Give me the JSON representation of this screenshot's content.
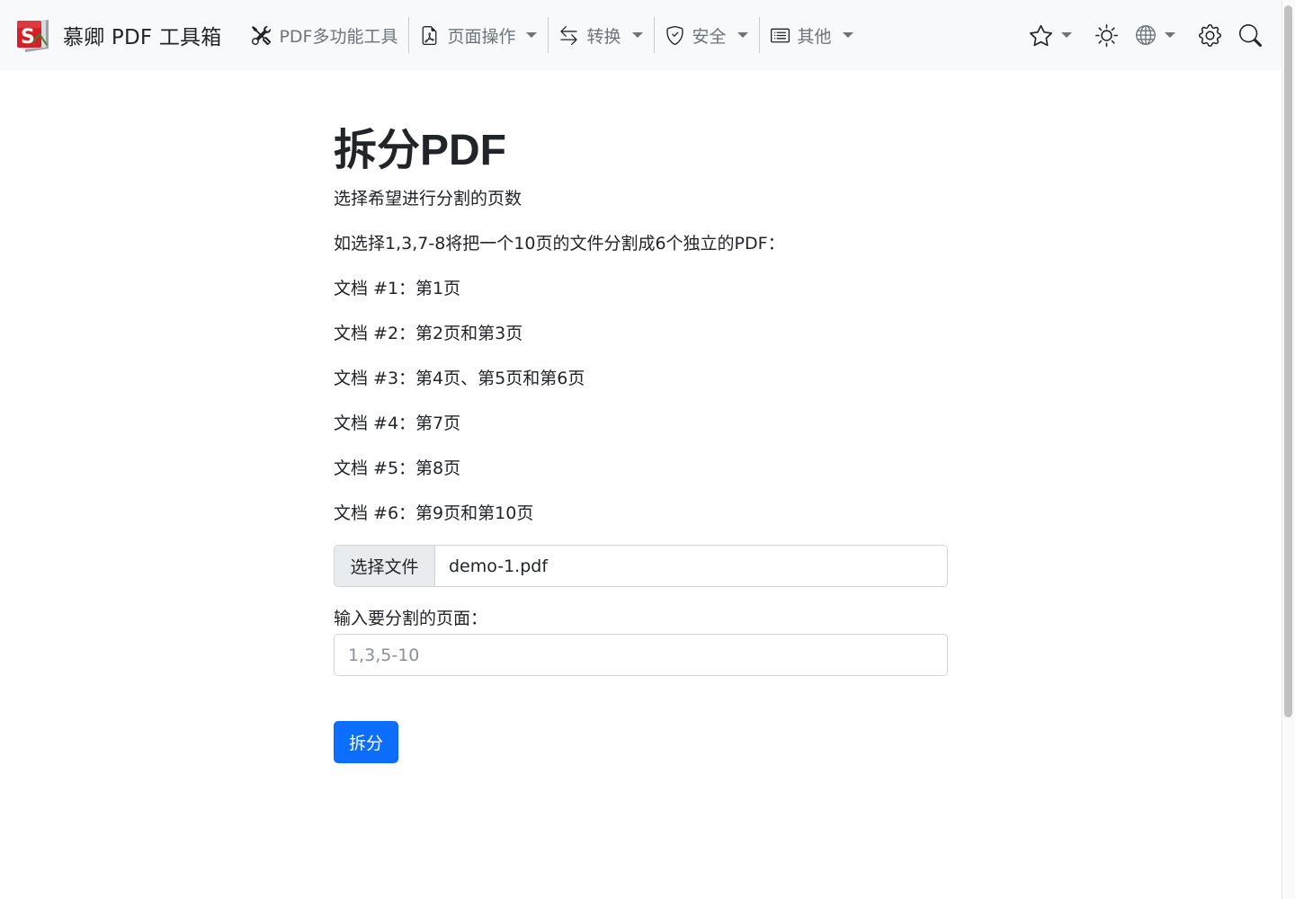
{
  "navbar": {
    "brand": "慕卿 PDF 工具箱",
    "items": [
      {
        "label": "PDF多功能工具",
        "icon": "tools-icon",
        "dropdown": false
      },
      {
        "label": "页面操作",
        "icon": "file-pdf-icon",
        "dropdown": true
      },
      {
        "label": "转换",
        "icon": "arrow-left-right-icon",
        "dropdown": true
      },
      {
        "label": "安全",
        "icon": "shield-check-icon",
        "dropdown": true
      },
      {
        "label": "其他",
        "icon": "card-list-icon",
        "dropdown": true
      }
    ],
    "right_icons": [
      "star-icon",
      "sun-icon",
      "globe-icon",
      "gear-icon",
      "search-icon"
    ]
  },
  "main": {
    "title": "拆分PDF",
    "description": "选择希望进行分割的页数",
    "example": "如选择1,3,7-8将把一个10页的文件分割成6个独立的PDF：",
    "docs": [
      "文档 #1：第1页",
      "文档 #2：第2页和第3页",
      "文档 #3：第4页、第5页和第6页",
      "文档 #4：第7页",
      "文档 #5：第8页",
      "文档 #6：第9页和第10页"
    ],
    "file_button": "选择文件",
    "file_name": "demo-1.pdf",
    "pages_label": "输入要分割的页面：",
    "pages_placeholder": "1,3,5-10",
    "pages_value": "",
    "submit": "拆分"
  },
  "colors": {
    "primary": "#0d6efd",
    "navbar_bg": "#f8f9fa",
    "muted_text": "#6c757d",
    "text": "#212529"
  }
}
